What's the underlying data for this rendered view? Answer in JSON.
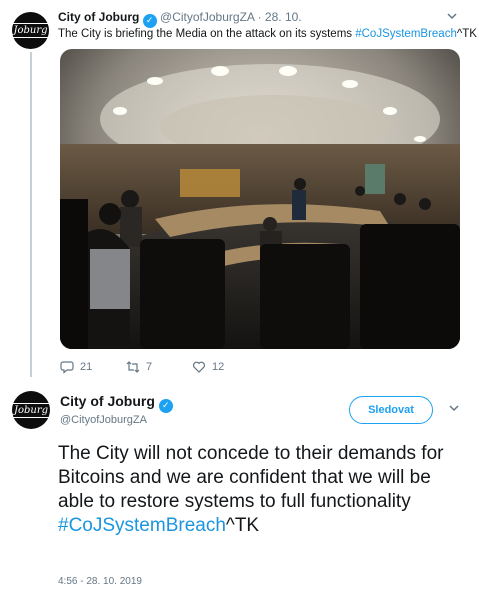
{
  "tweet1": {
    "avatar_text": "Joburg",
    "name": "City of Joburg",
    "handle": "@CityofJoburgZA",
    "date": "28. 10.",
    "text_prefix": "The City is briefing the Media on the attack on its systems ",
    "hashtag": "#CoJSystemBreach",
    "text_suffix": "^TK",
    "actions": {
      "replies": "21",
      "retweets": "7",
      "likes": "12"
    }
  },
  "tweet2": {
    "avatar_text": "Joburg",
    "name": "City of Joburg",
    "handle": "@CityofJoburgZA",
    "follow_label": "Sledovat",
    "text": "The City will not concede to their demands for Bitcoins and we are confident that we will be able to restore systems to full functionality",
    "hashtag": "#CoJSystemBreach",
    "text_suffix": "^TK",
    "timestamp": "4:56 - 28. 10. 2019"
  },
  "colors": {
    "accent": "#1da1f2",
    "hashtag": "#1b95e0",
    "muted": "#657786",
    "text": "#14171a"
  },
  "icons": [
    "verified-badge-icon",
    "chevron-down-icon",
    "reply-icon",
    "retweet-icon",
    "like-icon"
  ]
}
